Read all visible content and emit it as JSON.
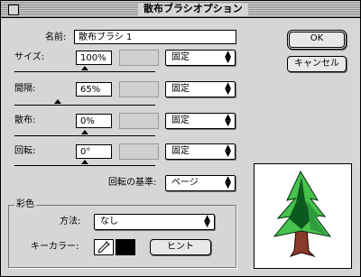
{
  "window": {
    "title": "散布ブラシオプション"
  },
  "name_field": {
    "label": "名前:",
    "value": "散布ブラシ 1"
  },
  "size": {
    "label": "サイズ:",
    "value": "100%",
    "mode": "固定",
    "slider_level": 0.5
  },
  "spacing": {
    "label": "間隔:",
    "value": "65%",
    "mode": "固定",
    "slider_level": 0.36
  },
  "scatter": {
    "label": "散布:",
    "value": "0%",
    "mode": "固定",
    "slider_level": 0.5
  },
  "rotation": {
    "label": "回転:",
    "value": "0°",
    "mode": "固定",
    "slider_level": 0.5
  },
  "rotation_basis": {
    "label": "回転の基準:",
    "value": "ページ"
  },
  "colorization": {
    "group_label": "彩色",
    "method_label": "方法:",
    "method_value": "なし",
    "key_color_label": "キーカラー:",
    "key_color": "#000000",
    "hint_button": "ヒント"
  },
  "buttons": {
    "ok": "OK",
    "cancel": "キャンセル"
  },
  "icons": {
    "eyedropper": "eyedropper-icon",
    "popup_arrows": "up-down-arrows-icon"
  },
  "preview": {
    "tree_greens": [
      "#0a5a1e",
      "#2f9a3e",
      "#47c24c"
    ],
    "trunk": "#8a3a2a"
  }
}
